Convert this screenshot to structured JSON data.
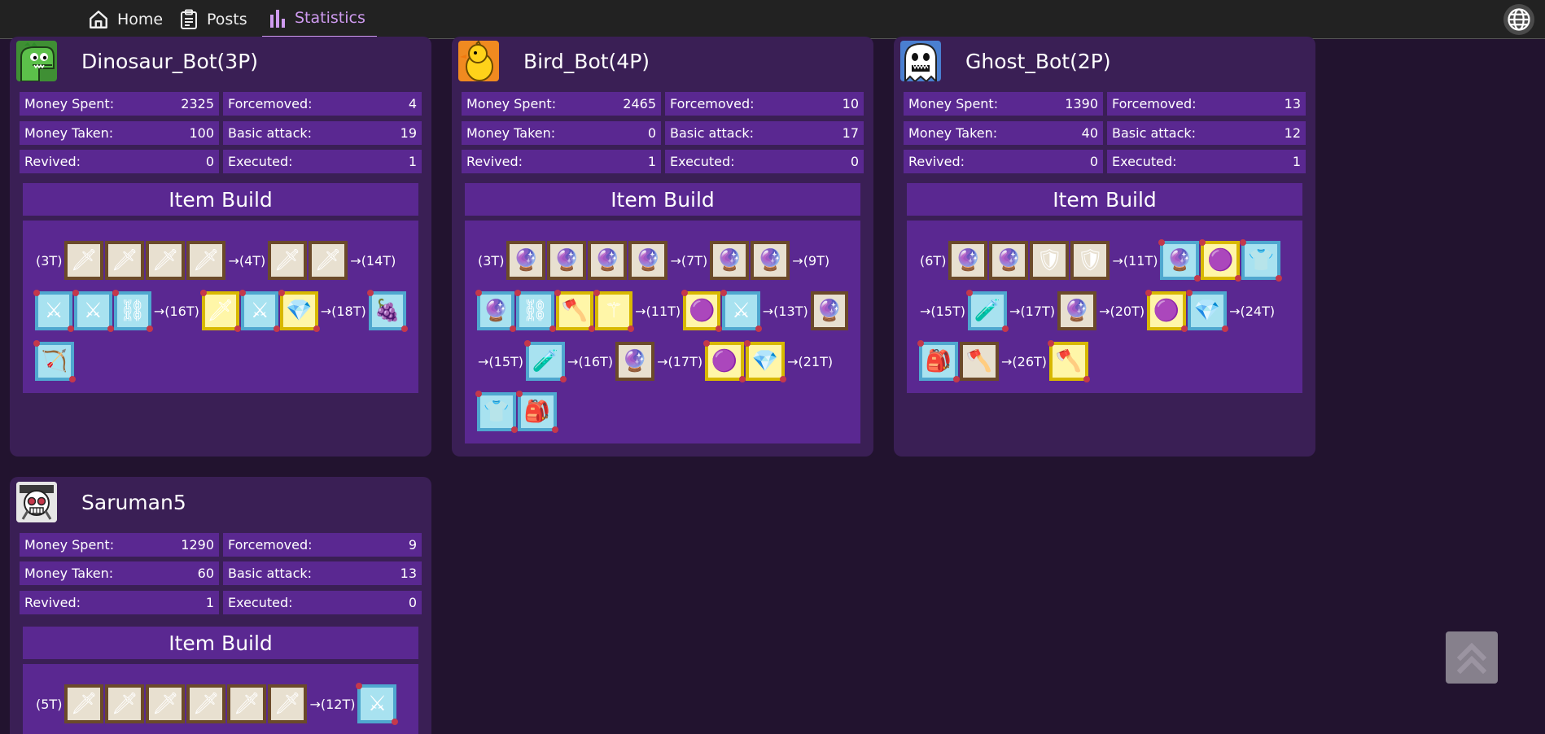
{
  "nav": {
    "home": "Home",
    "posts": "Posts",
    "statistics": "Statistics"
  },
  "icons": {
    "home": "home-icon",
    "posts": "clipboard-icon",
    "statistics": "bar-chart-icon",
    "globe": "globe-icon",
    "scroll_top": "double-chevron-up-icon"
  },
  "colors": {
    "accent": "#cf9bf0",
    "card_bg": "#3a1f55",
    "panel_bg": "#5a2891",
    "page_bg": "#22132f"
  },
  "labels": {
    "money_spent": "Money Spent:",
    "money_taken": "Money Taken:",
    "revived": "Revived:",
    "forcemoved": "Forcemoved:",
    "basic_attack": "Basic attack:",
    "executed": "Executed:",
    "item_build": "Item Build"
  },
  "players": [
    {
      "name": "Dinosaur_Bot(3P)",
      "avatar": "dinosaur-avatar",
      "money_spent": "2325",
      "money_taken": "100",
      "revived": "0",
      "forcemoved": "4",
      "basic_attack": "19",
      "executed": "1",
      "build_rows": [
        [
          "(3T)",
          "sword",
          "sword",
          "sword",
          "sword",
          "→(4T)",
          "sword",
          "sword",
          "→(14T)"
        ],
        [
          "blue-sword",
          "blue-crossed",
          "blue-chain",
          "→(16T)",
          "yellow-sword",
          "blue-red-crossed",
          "yellow-crystal",
          "→(18T)",
          "blue-grapes"
        ],
        [
          "blue-bow"
        ]
      ]
    },
    {
      "name": "Bird_Bot(4P)",
      "avatar": "bird-avatar",
      "money_spent": "2465",
      "money_taken": "0",
      "revived": "1",
      "forcemoved": "10",
      "basic_attack": "17",
      "executed": "0",
      "build_rows": [
        [
          "(3T)",
          "orb",
          "orb",
          "orb",
          "orb",
          "→(7T)",
          "orb",
          "orb",
          "→(9T)"
        ],
        [
          "blue-orb",
          "blue-chain",
          "yellow-axe",
          "yellow-staff",
          "→(11T)",
          "yellow-purple-orb",
          "blue-crossed",
          "→(13T)",
          "orb"
        ],
        [
          "→(15T)",
          "blue-potion",
          "→(16T)",
          "orb",
          "→(17T)",
          "yellow-purple-orb",
          "yellow-crystal",
          "→(21T)"
        ],
        [
          "blue-armor",
          "blue-bag"
        ]
      ]
    },
    {
      "name": "Ghost_Bot(2P)",
      "avatar": "ghost-avatar",
      "money_spent": "1390",
      "money_taken": "40",
      "revived": "0",
      "forcemoved": "13",
      "basic_attack": "12",
      "executed": "1",
      "build_rows": [
        [
          "(6T)",
          "orb",
          "orb",
          "shield",
          "shield",
          "→(11T)",
          "blue-orb",
          "yellow-purple-orb",
          "blue-armor"
        ],
        [
          "→(15T)",
          "blue-potion",
          "→(17T)",
          "orb",
          "→(20T)",
          "yellow-purple-orb",
          "blue-crystal",
          "→(24T)"
        ],
        [
          "blue-bag",
          "axe",
          "→(26T)",
          "yellow-axe"
        ]
      ]
    },
    {
      "name": "Saruman5",
      "avatar": "skull-avatar",
      "money_spent": "1290",
      "money_taken": "60",
      "revived": "1",
      "forcemoved": "9",
      "basic_attack": "13",
      "executed": "0",
      "build_rows": [
        [
          "(5T)",
          "sword",
          "sword",
          "sword",
          "sword",
          "sword",
          "sword",
          "→(12T)",
          "blue-sword"
        ]
      ]
    }
  ]
}
